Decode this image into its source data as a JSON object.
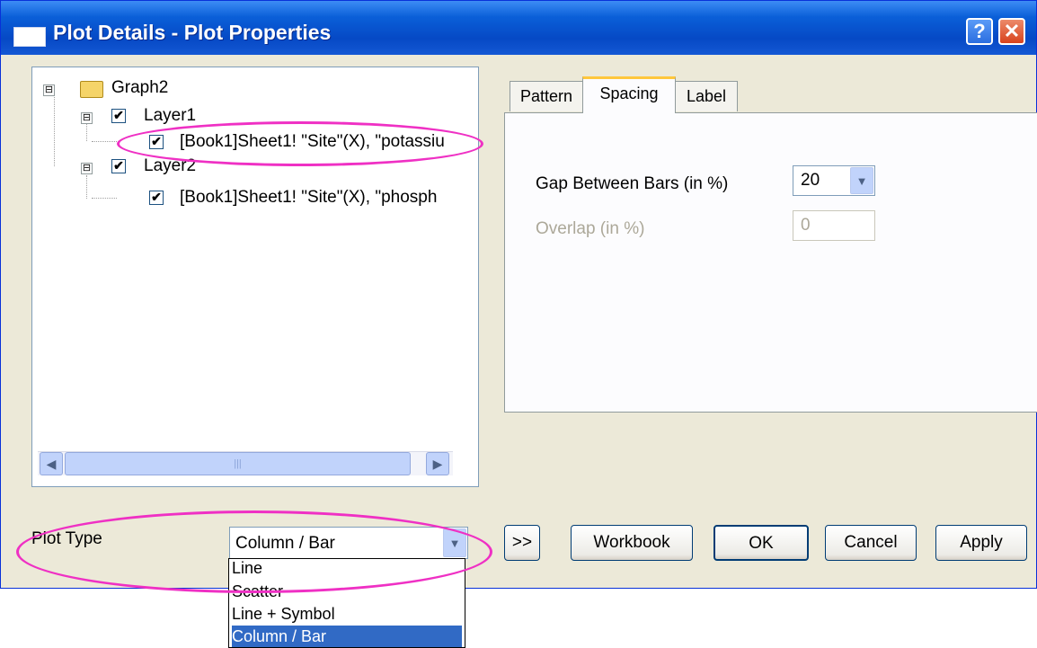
{
  "window": {
    "title": "Plot Details - Plot Properties",
    "help_label": "?",
    "close_label": "✕"
  },
  "tree": {
    "root": {
      "label": "Graph2",
      "expander": "⊟"
    },
    "layers": [
      {
        "label": "Layer1",
        "expander": "⊟",
        "checked": "✔",
        "plots": [
          {
            "label": "[Book1]Sheet1! \"Site\"(X), \"potassiu",
            "checked": "✔"
          }
        ]
      },
      {
        "label": "Layer2",
        "expander": "⊟",
        "checked": "✔",
        "plots": [
          {
            "label": "[Book1]Sheet1! \"Site\"(X), \"phosph",
            "checked": "✔"
          }
        ]
      }
    ],
    "scroll_left": "◀",
    "scroll_right": "▶",
    "scroll_grip": "|||"
  },
  "tabs": [
    {
      "label": "Pattern"
    },
    {
      "label": "Spacing"
    },
    {
      "label": "Label"
    }
  ],
  "active_tab": "Spacing",
  "spacing": {
    "gap_label": "Gap Between Bars (in %)",
    "gap_value": "20",
    "overlap_label": "Overlap (in %)",
    "overlap_value": "0"
  },
  "plot_type": {
    "label": "Plot Type",
    "selected": "Column / Bar",
    "options": [
      "Line",
      "Scatter",
      "Line + Symbol",
      "Column / Bar"
    ]
  },
  "buttons": {
    "expand": ">>",
    "workbook": "Workbook",
    "ok": "OK",
    "cancel": "Cancel",
    "apply": "Apply"
  },
  "icons": {
    "dropdown": "chevron-down-icon",
    "folder": "folder-icon"
  },
  "colors": {
    "highlight_ellipse": "#ef30c4",
    "title_bar": "#0a5fd8",
    "selection": "#316ac5"
  }
}
